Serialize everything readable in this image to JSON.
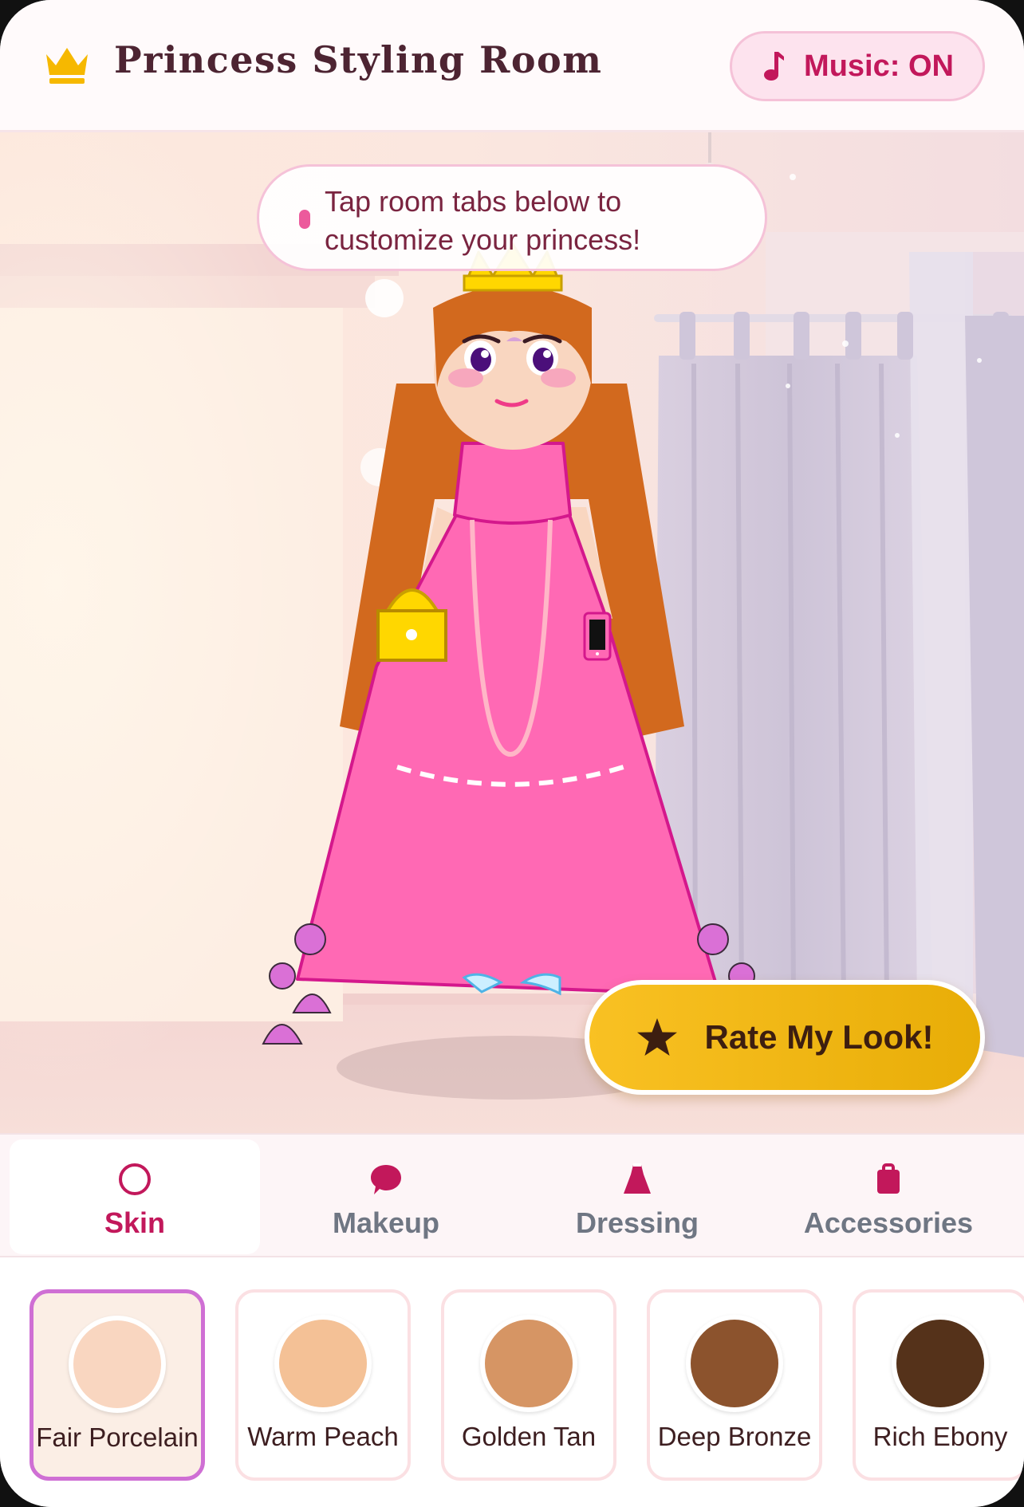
{
  "header": {
    "title": "Princess Styling Room",
    "music_label": "Music: ON",
    "icons": {
      "logo": "crown-icon",
      "music": "music-note-icon"
    }
  },
  "scene": {
    "tip": "Tap room tabs below to customize your princess!",
    "rate_label": "Rate My Look!",
    "rate_icon": "star-icon"
  },
  "tabs": [
    {
      "label": "Skin",
      "icon": "circle-outline-icon",
      "active": true
    },
    {
      "label": "Makeup",
      "icon": "speech-bubble-icon",
      "active": false
    },
    {
      "label": "Dressing",
      "icon": "dress-icon",
      "active": false
    },
    {
      "label": "Accessories",
      "icon": "bag-icon",
      "active": false
    }
  ],
  "swatches": [
    {
      "label": "Fair Porcelain",
      "color": "#f9d6c0",
      "selected": true
    },
    {
      "label": "Warm Peach",
      "color": "#f4c196",
      "selected": false
    },
    {
      "label": "Golden Tan",
      "color": "#d69564",
      "selected": false
    },
    {
      "label": "Deep Bronze",
      "color": "#8c532d",
      "selected": false
    },
    {
      "label": "Rich Ebony",
      "color": "#55321a",
      "selected": false
    }
  ],
  "colors": {
    "accent": "#c2185b",
    "dress": "#ff69b4",
    "hair": "#d2691e",
    "rate_button": "#f9c123"
  }
}
